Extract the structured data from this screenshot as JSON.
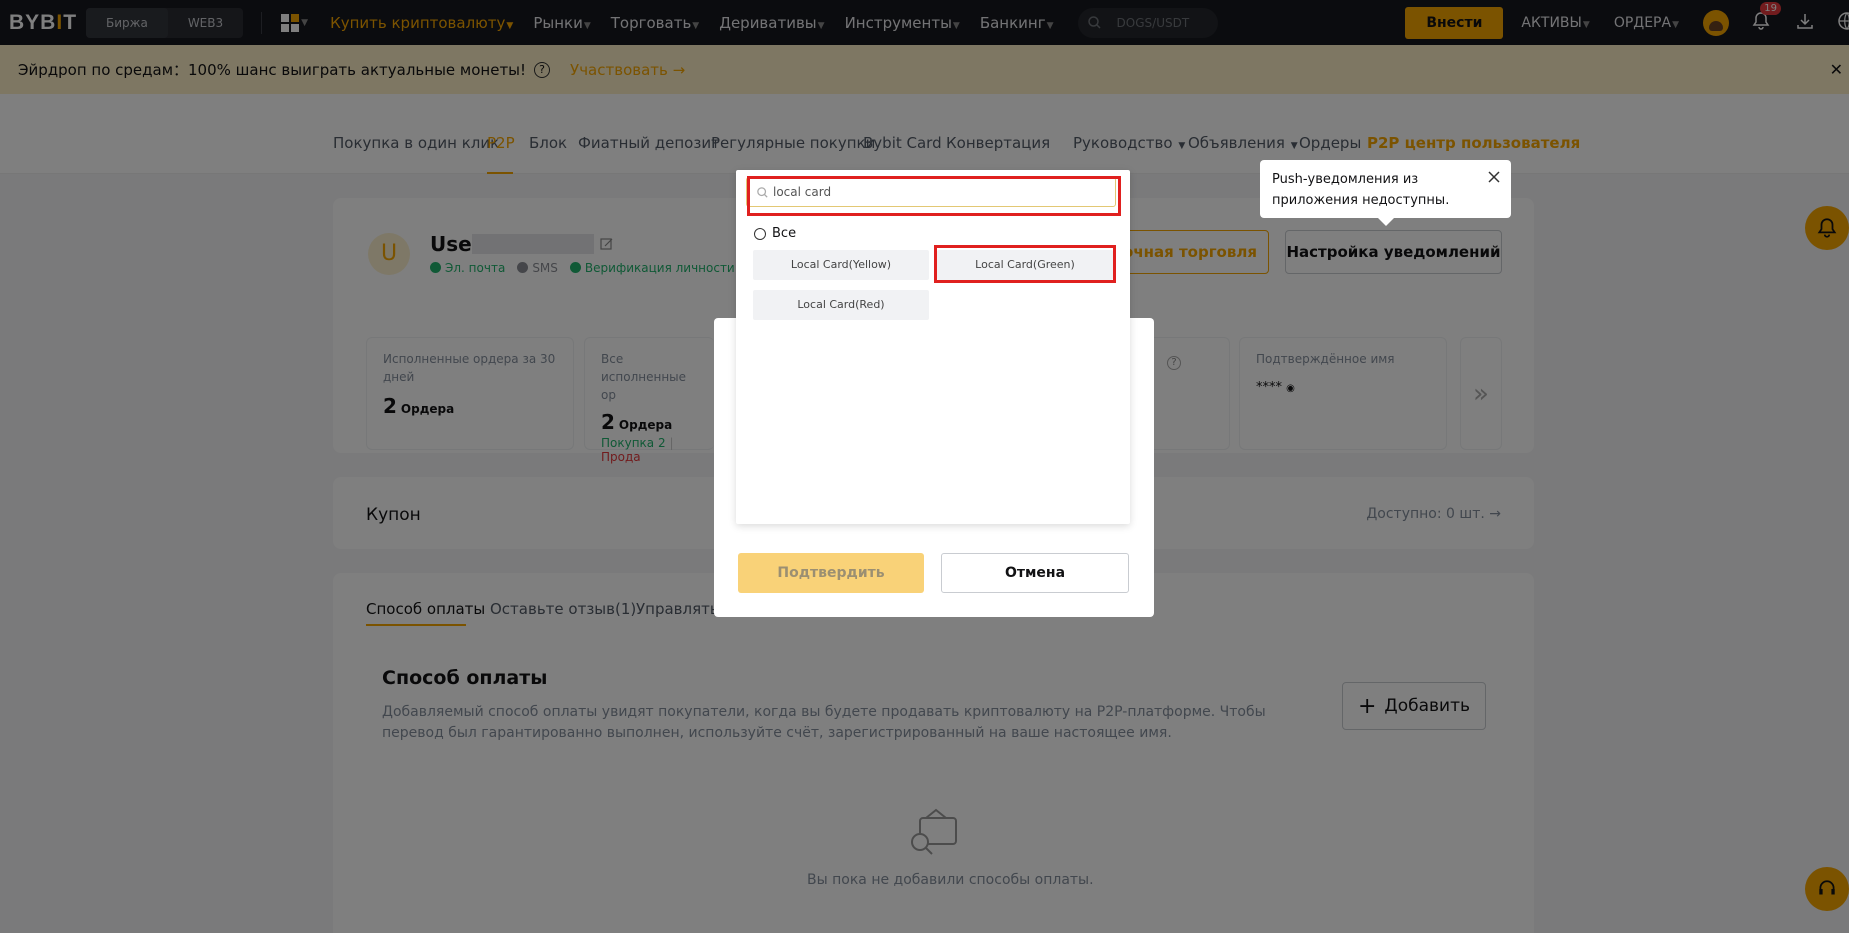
{
  "topbar": {
    "logo": "BYBIT",
    "segments": [
      "Биржа",
      "WEB3"
    ],
    "nav": [
      "Купить криптовалюту",
      "Рынки",
      "Торговать",
      "Деривативы",
      "Инструменты",
      "Банкинг"
    ],
    "search_placeholder": "DOGS/USDT",
    "deposit_label": "Внести",
    "assets_label": "АКТИВЫ",
    "orders_label": "ОРДЕРА",
    "notification_count": "19"
  },
  "banner": {
    "text": "Эйрдроп по средам：100% шанс выиграть актуальные монеты!",
    "join_label": "Участвовать"
  },
  "subnav": {
    "items": [
      "Покупка в один клик",
      "P2P",
      "Блок",
      "Фиатный депозит",
      "Регулярные покупки",
      "Bybit Card",
      "Конвертация",
      "Руководство",
      "Объявления",
      "Ордеры",
      "P2P центр пользователя"
    ]
  },
  "profile": {
    "initial": "U",
    "username": "User",
    "verifications": [
      "Эл. почта",
      "SMS",
      "Верификация личности"
    ],
    "bulk_trade_label": "лочная торговля",
    "notify_settings_label": "Настройка уведомлений"
  },
  "stats": [
    {
      "label": "Исполненные ордера за 30 дней",
      "value": "2",
      "unit": "Ордера"
    },
    {
      "label": "Все исполненные ор",
      "value": "2",
      "unit": "Ордера",
      "buy": "Покупка 2",
      "sell": "Прода"
    },
    {
      "label": "Подтверждённое имя",
      "value": "****"
    }
  ],
  "coupon": {
    "title": "Купон",
    "available": "Доступно: 0 шт."
  },
  "tabs": [
    "Способ оплаты",
    "Оставьте отзыв(1)",
    "Управлять ч"
  ],
  "payment": {
    "title": "Способ оплаты",
    "description": "Добавляемый способ оплаты увидят покупатели, когда вы будете продавать криптовалюту на P2P-платформе. Чтобы перевод был гарантированно выполнен, используйте счёт, зарегистрированный на ваше настоящее имя.",
    "add_label": "Добавить",
    "empty_text": "Вы пока не добавили способы оплаты."
  },
  "modal": {
    "confirm_label": "Подтвердить",
    "cancel_label": "Отмена"
  },
  "dropdown": {
    "search_value": "local card",
    "all_label": "Все",
    "options": [
      "Local Card(Yellow)",
      "Local Card(Green)",
      "Local Card(Red)"
    ]
  },
  "tooltip": {
    "text": "Push-уведомления из приложения недоступны."
  },
  "colors": {
    "brand": "#f7a600",
    "highlight": "#e0201f",
    "success": "#20b26c"
  }
}
